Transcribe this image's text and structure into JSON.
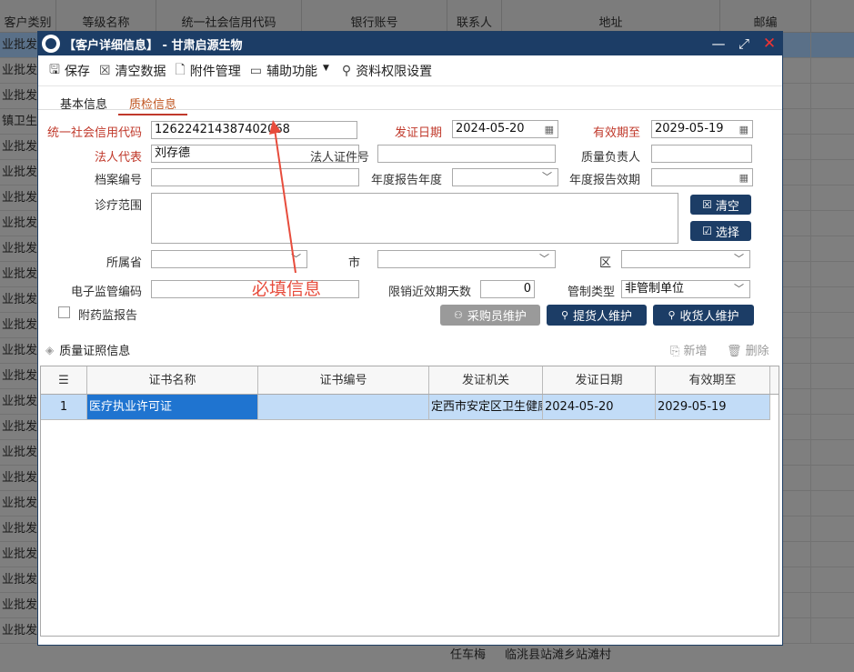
{
  "background": {
    "headers": [
      "客户类别",
      "等级名称",
      "统一社会信用代码",
      "银行账号",
      "联系人",
      "地址",
      "邮编"
    ],
    "row_prefixes": [
      "业批发",
      "业批发",
      "业批发",
      "镇卫生院",
      "业批发",
      "业批发",
      "业批发",
      "业批发",
      "业批发",
      "业批发",
      "业批发",
      "业批发",
      "业批发",
      "业批发",
      "业批发",
      "业批发",
      "业批发",
      "业批发",
      "业批发",
      "业批发",
      "业批发",
      "业批发",
      "业批发",
      "业批发"
    ],
    "bottom_contact": "任车梅",
    "bottom_address": "临洮县站滩乡站滩村"
  },
  "dialog": {
    "title": "【客户详细信息】 - 甘肃启源生物",
    "toolbar": {
      "save": "保存",
      "clear_data": "清空数据",
      "attachments": "附件管理",
      "aux": "辅助功能",
      "permissions": "资料权限设置"
    },
    "tabs": [
      "基本信息",
      "质检信息"
    ],
    "form": {
      "credit_code_label": "统一社会信用代码",
      "credit_code_value": "126224214387402068",
      "issue_date_label": "发证日期",
      "issue_date_value": "2024-05-20",
      "expiry_label": "有效期至",
      "expiry_value": "2029-05-19",
      "legal_rep_label": "法人代表",
      "legal_rep_value": "刘存德",
      "legal_id_label": "法人证件号",
      "quality_head_label": "质量负责人",
      "archive_no_label": "档案编号",
      "annual_year_label": "年度报告年度",
      "annual_valid_label": "年度报告效期",
      "scope_label": "诊疗范围",
      "clear_btn": "清空",
      "select_btn": "选择",
      "province_label": "所属省",
      "city_label": "市",
      "district_label": "区",
      "esup_label": "电子监管编码",
      "limit_days_label": "限销近效期天数",
      "limit_days_value": "0",
      "control_type_label": "管制类型",
      "control_type_value": "非管制单位",
      "attach_report_label": "附药监报告",
      "buyer_btn": "采购员维护",
      "supplier_btn": "提货人维护",
      "receiver_btn": "收货人维护"
    },
    "annotation": "必填信息",
    "section": {
      "title": "质量证照信息",
      "add": "新增",
      "delete": "删除"
    },
    "grid": {
      "columns": [
        "证书名称",
        "证书编号",
        "发证机关",
        "发证日期",
        "有效期至"
      ],
      "rows": [
        {
          "index": "1",
          "name": "医疗执业许可证",
          "number": "",
          "authority": "定西市安定区卫生健康",
          "issue": "2024-05-20",
          "expiry": "2029-05-19"
        }
      ]
    }
  }
}
